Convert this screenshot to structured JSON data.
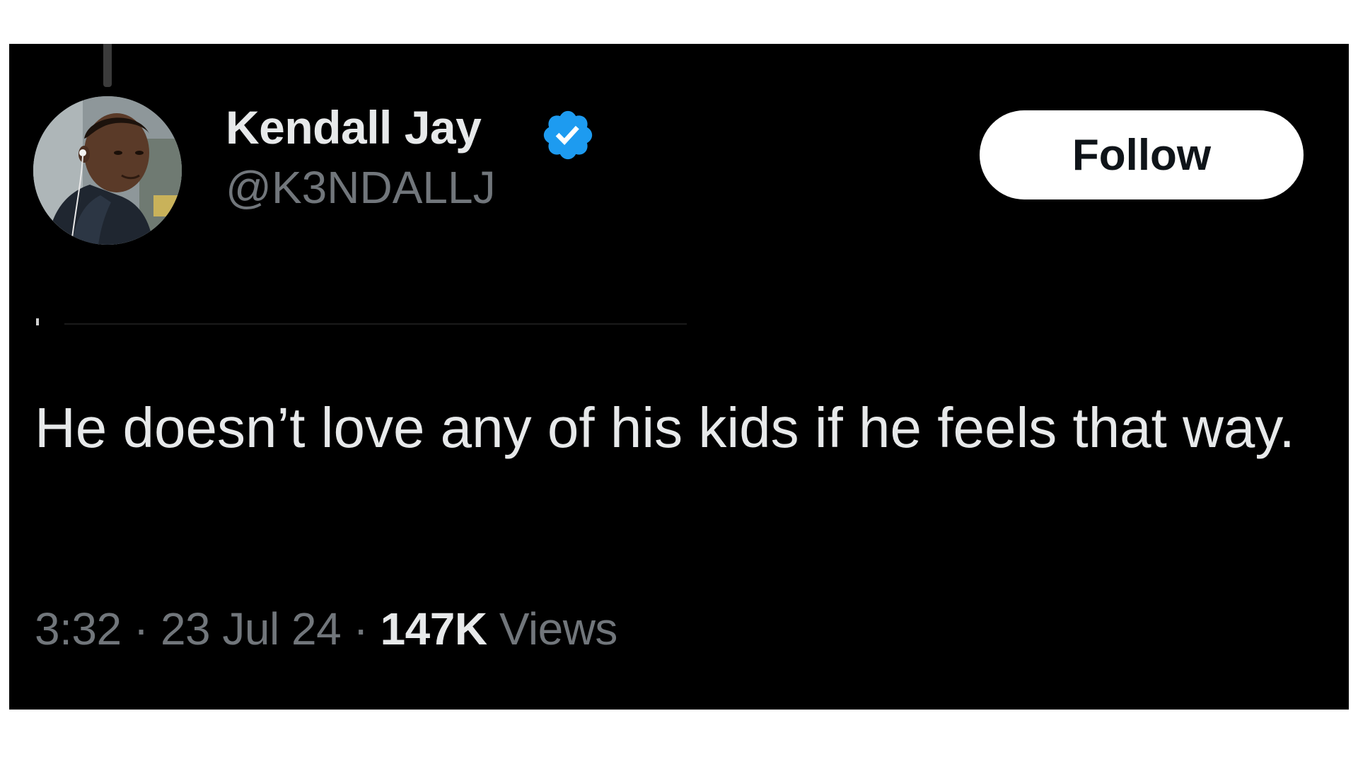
{
  "author": {
    "display_name": "Kendall Jay",
    "handle": "@K3NDALLJ",
    "verified": true,
    "avatar_icon": "avatar-photo"
  },
  "follow_button": {
    "label": "Follow"
  },
  "tweet": {
    "text": "He doesn’t love any of his kids if he feels that way."
  },
  "meta": {
    "time": "3:32",
    "separator": "·",
    "date": "23 Jul 24",
    "views_count": "147K",
    "views_label": "Views"
  },
  "colors": {
    "background": "#000000",
    "primary_text": "#e7e9ea",
    "secondary_text": "#71767b",
    "verified_badge": "#1d9bf0",
    "button_bg": "#ffffff",
    "button_text": "#0f1419"
  }
}
